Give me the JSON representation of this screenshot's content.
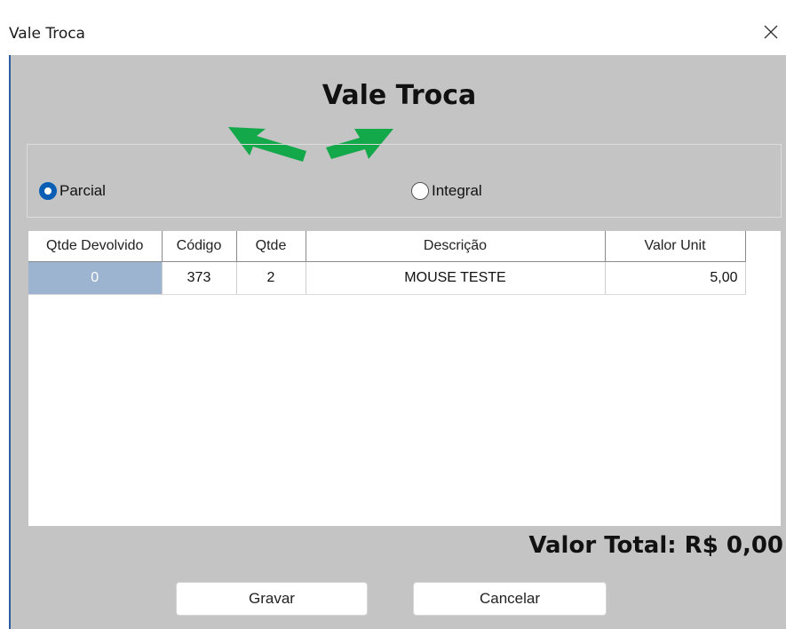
{
  "window": {
    "title": "Vale Troca",
    "close_icon": "close-icon"
  },
  "form": {
    "heading": "Vale Troca",
    "mode_options": [
      {
        "label": "Parcial",
        "selected": true
      },
      {
        "label": "Integral",
        "selected": false
      }
    ],
    "arrow_color": "#13a84a",
    "accent": "#0a5fb4"
  },
  "grid": {
    "columns": [
      "Qtde Devolvido",
      "Código",
      "Qtde",
      "Descrição",
      "Valor Unit"
    ],
    "rows": [
      {
        "qtde_devolvido": "0",
        "codigo": "373",
        "qtde": "2",
        "descricao": "MOUSE TESTE",
        "valor_unit": "5,00"
      }
    ]
  },
  "total": {
    "text": "Valor Total: R$ 0,00"
  },
  "buttons": {
    "save": "Gravar",
    "cancel": "Cancelar"
  }
}
